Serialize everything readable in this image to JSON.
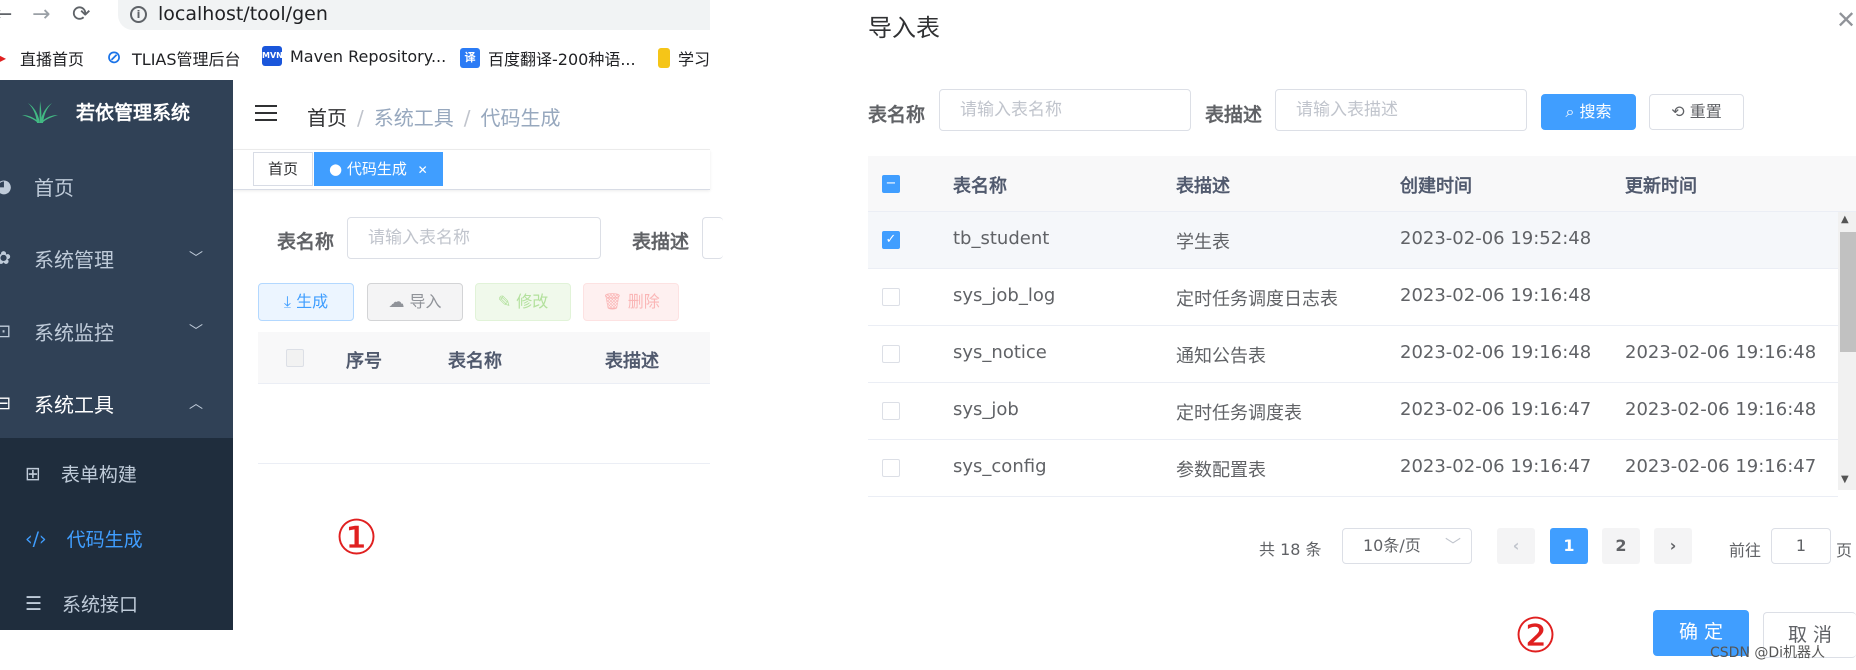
{
  "browser": {
    "url": "localhost/tool/gen",
    "bookmarks": [
      "直播首页",
      "TLIAS管理后台",
      "Maven Repository...",
      "百度翻译-200种语...",
      "学习"
    ]
  },
  "sidebar": {
    "brand": "若依管理系统",
    "items": [
      {
        "label": "首页",
        "icon": "dashboard-icon"
      },
      {
        "label": "系统管理",
        "icon": "gear-icon"
      },
      {
        "label": "系统监控",
        "icon": "monitor-icon"
      },
      {
        "label": "系统工具",
        "icon": "toolbox-icon"
      }
    ],
    "subitems": [
      {
        "label": "表单构建",
        "icon": "grid-icon"
      },
      {
        "label": "代码生成",
        "icon": "code-icon"
      },
      {
        "label": "系统接口",
        "icon": "sliders-icon"
      }
    ]
  },
  "breadcrumb": {
    "home": "首页",
    "section": "系统工具",
    "page": "代码生成",
    "sep": "/"
  },
  "tags": {
    "home": "首页",
    "active": "代码生成"
  },
  "left_search": {
    "name_label": "表名称",
    "name_placeholder": "请输入表名称",
    "desc_label": "表描述"
  },
  "left_toolbar": {
    "generate": "生成",
    "import": "导入",
    "edit": "修改",
    "delete": "删除"
  },
  "left_table": {
    "headers": [
      "序号",
      "表名称",
      "表描述"
    ]
  },
  "markers": {
    "one": "①",
    "two": "②"
  },
  "dialog": {
    "title": "导入表",
    "name_label": "表名称",
    "name_placeholder": "请输入表名称",
    "desc_label": "表描述",
    "desc_placeholder": "请输入表描述",
    "search": "搜索",
    "reset": "重置",
    "headers": [
      "表名称",
      "表描述",
      "创建时间",
      "更新时间"
    ],
    "rows": [
      {
        "name": "tb_student",
        "desc": "学生表",
        "created": "2023-02-06 19:52:48",
        "updated": "",
        "checked": true
      },
      {
        "name": "sys_job_log",
        "desc": "定时任务调度日志表",
        "created": "2023-02-06 19:16:48",
        "updated": "",
        "checked": false
      },
      {
        "name": "sys_notice",
        "desc": "通知公告表",
        "created": "2023-02-06 19:16:48",
        "updated": "2023-02-06 19:16:48",
        "checked": false
      },
      {
        "name": "sys_job",
        "desc": "定时任务调度表",
        "created": "2023-02-06 19:16:47",
        "updated": "2023-02-06 19:16:48",
        "checked": false
      },
      {
        "name": "sys_config",
        "desc": "参数配置表",
        "created": "2023-02-06 19:16:47",
        "updated": "2023-02-06 19:16:47",
        "checked": false
      }
    ],
    "pagination": {
      "total": "共 18 条",
      "page_size": "10条/页",
      "pages": [
        "1",
        "2"
      ],
      "current": "1",
      "goto_prefix": "前往",
      "goto_value": "1",
      "goto_suffix": "页"
    },
    "confirm": "确 定",
    "cancel": "取 消"
  },
  "watermark": "CSDN @Di机器人",
  "colors": {
    "primary": "#409eff",
    "sidebar": "#304156",
    "submenu": "#1f2d3d",
    "marker": "#e02020"
  }
}
